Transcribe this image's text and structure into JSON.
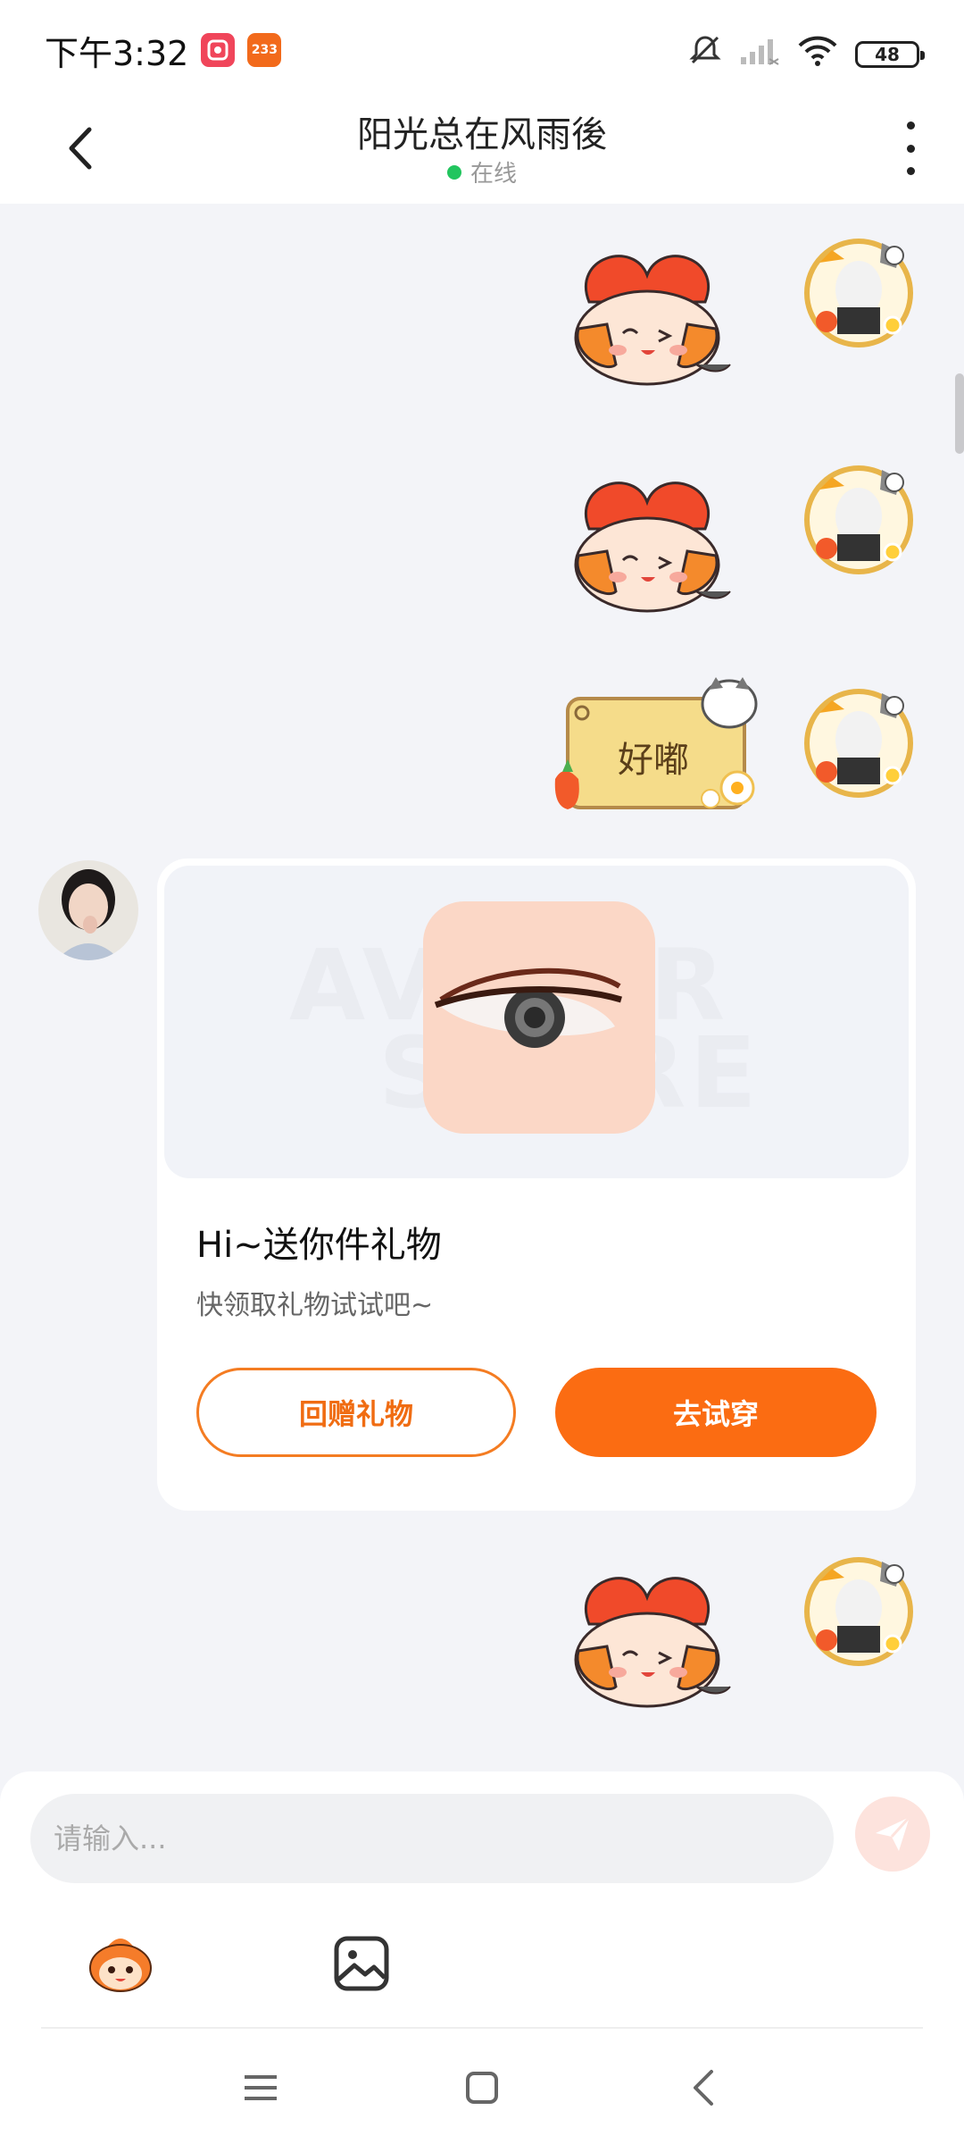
{
  "status_bar": {
    "time": "下午3:32",
    "app_badges": [
      {
        "name": "hongshou-app-icon",
        "label": "",
        "color": "#f0455a"
      },
      {
        "name": "233-app-icon",
        "label": "233",
        "color": "#f26a1b"
      }
    ],
    "battery": "48",
    "icons": [
      "bell-muted-icon",
      "signal-icon",
      "wifi-icon",
      "battery-icon"
    ]
  },
  "header": {
    "title": "阳光总在风雨後",
    "status": "在线",
    "status_color": "#22c55e"
  },
  "messages": [
    {
      "from": "self",
      "type": "sticker",
      "sticker": "hug-heart-sticker"
    },
    {
      "from": "self",
      "type": "sticker",
      "sticker": "hug-heart-sticker"
    },
    {
      "from": "self",
      "type": "sticker-text",
      "text": "好嘟"
    },
    {
      "from": "peer",
      "type": "gift",
      "watermark_1": "AVATAR",
      "watermark_2": "STORE",
      "title": "Hi~送你件礼物",
      "subtitle": "快领取礼物试试吧~",
      "return_label": "回赠礼物",
      "try_label": "去试穿"
    },
    {
      "from": "self",
      "type": "sticker",
      "sticker": "hug-heart-sticker"
    }
  ],
  "input": {
    "placeholder": "请输入...",
    "value": ""
  },
  "tools": [
    "mascot-emoji-icon",
    "image-icon"
  ],
  "colors": {
    "accent": "#fb6c12",
    "background": "#f3f4f8",
    "send_disabled": "#fde3dd"
  },
  "nav": [
    "menu-icon",
    "home-icon",
    "back-icon"
  ]
}
